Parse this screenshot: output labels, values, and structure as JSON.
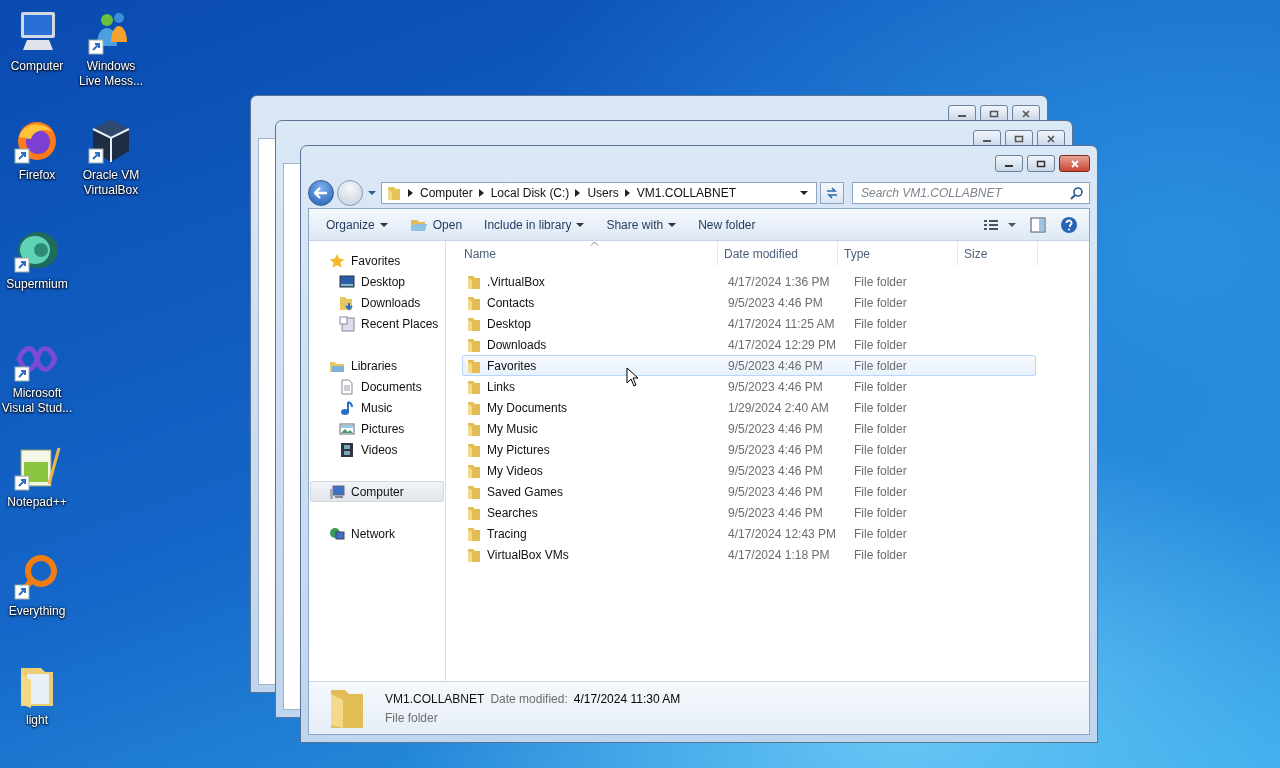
{
  "desktop_icons": [
    {
      "label": "Computer",
      "kind": "computer",
      "shortcut": false
    },
    {
      "label": "Windows Live Mess...",
      "kind": "messenger",
      "shortcut": true
    },
    {
      "label": "Firefox",
      "kind": "firefox",
      "shortcut": true
    },
    {
      "label": "Oracle VM VirtualBox",
      "kind": "virtualbox",
      "shortcut": true
    },
    {
      "label": "Supermium",
      "kind": "supermium",
      "shortcut": true
    },
    {
      "label": "Microsoft Visual Stud...",
      "kind": "visualstudio",
      "shortcut": true
    },
    {
      "label": "Notepad++",
      "kind": "notepad",
      "shortcut": true
    },
    {
      "label": "Everything",
      "kind": "everything",
      "shortcut": true
    },
    {
      "label": "light",
      "kind": "folder",
      "shortcut": false
    }
  ],
  "explorer": {
    "breadcrumb": [
      "Computer",
      "Local Disk (C:)",
      "Users",
      "VM1.COLLABNET"
    ],
    "search": {
      "placeholder": "Search VM1.COLLABNET"
    },
    "toolbar": [
      {
        "label": "Organize",
        "dropdown": true,
        "has_icon": false
      },
      {
        "label": "Open",
        "dropdown": false,
        "has_icon": true
      },
      {
        "label": "Include in library",
        "dropdown": true,
        "has_icon": false
      },
      {
        "label": "Share with",
        "dropdown": true,
        "has_icon": false
      },
      {
        "label": "New folder",
        "dropdown": false,
        "has_icon": false
      }
    ],
    "nav": [
      {
        "label": "Favorites",
        "kind": "star",
        "selected": false,
        "children": [
          {
            "label": "Desktop",
            "kind": "desktop",
            "selected": false
          },
          {
            "label": "Downloads",
            "kind": "downloads",
            "selected": false
          },
          {
            "label": "Recent Places",
            "kind": "recent",
            "selected": false
          }
        ]
      },
      {
        "label": "Libraries",
        "kind": "libraries",
        "selected": false,
        "children": [
          {
            "label": "Documents",
            "kind": "documents",
            "selected": false
          },
          {
            "label": "Music",
            "kind": "music",
            "selected": false
          },
          {
            "label": "Pictures",
            "kind": "pictures",
            "selected": false
          },
          {
            "label": "Videos",
            "kind": "videos",
            "selected": false
          }
        ]
      },
      {
        "label": "Computer",
        "kind": "computer",
        "selected": true
      },
      {
        "label": "Network",
        "kind": "network",
        "selected": false
      }
    ],
    "columns": [
      {
        "label": "Name",
        "sorted": true
      },
      {
        "label": "Date modified",
        "sorted": false
      },
      {
        "label": "Type",
        "sorted": false
      },
      {
        "label": "Size",
        "sorted": false
      }
    ],
    "rows": [
      {
        "name": ".VirtualBox",
        "date": "4/17/2024 1:36 PM",
        "type": "File folder",
        "hovered": false
      },
      {
        "name": "Contacts",
        "date": "9/5/2023 4:46 PM",
        "type": "File folder",
        "hovered": false
      },
      {
        "name": "Desktop",
        "date": "4/17/2024 11:25 AM",
        "type": "File folder",
        "hovered": false
      },
      {
        "name": "Downloads",
        "date": "4/17/2024 12:29 PM",
        "type": "File folder",
        "hovered": false
      },
      {
        "name": "Favorites",
        "date": "9/5/2023 4:46 PM",
        "type": "File folder",
        "hovered": true
      },
      {
        "name": "Links",
        "date": "9/5/2023 4:46 PM",
        "type": "File folder",
        "hovered": false
      },
      {
        "name": "My Documents",
        "date": "1/29/2024 2:40 AM",
        "type": "File folder",
        "hovered": false
      },
      {
        "name": "My Music",
        "date": "9/5/2023 4:46 PM",
        "type": "File folder",
        "hovered": false
      },
      {
        "name": "My Pictures",
        "date": "9/5/2023 4:46 PM",
        "type": "File folder",
        "hovered": false
      },
      {
        "name": "My Videos",
        "date": "9/5/2023 4:46 PM",
        "type": "File folder",
        "hovered": false
      },
      {
        "name": "Saved Games",
        "date": "9/5/2023 4:46 PM",
        "type": "File folder",
        "hovered": false
      },
      {
        "name": "Searches",
        "date": "9/5/2023 4:46 PM",
        "type": "File folder",
        "hovered": false
      },
      {
        "name": "Tracing",
        "date": "4/17/2024 12:43 PM",
        "type": "File folder",
        "hovered": false
      },
      {
        "name": "VirtualBox VMs",
        "date": "4/17/2024 1:18 PM",
        "type": "File folder",
        "hovered": false
      }
    ],
    "details": {
      "name": "VM1.COLLABNET",
      "date_label": "Date modified:",
      "date": "4/17/2024 11:30 AM",
      "type": "File folder"
    }
  }
}
